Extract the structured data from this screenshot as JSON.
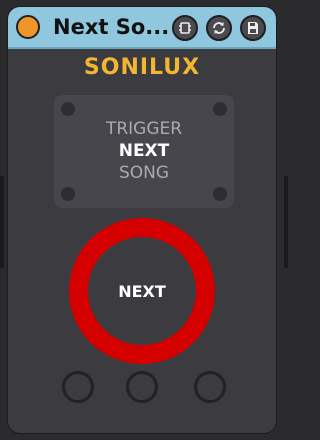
{
  "window": {
    "title": "Next So...",
    "status_color": "#f0952b",
    "buttons": [
      {
        "name": "device-icon"
      },
      {
        "name": "refresh-icon"
      },
      {
        "name": "save-icon"
      }
    ]
  },
  "brand": "SONILUX",
  "panel": {
    "line1": "TRIGGER",
    "line2": "NEXT",
    "line3": "SONG"
  },
  "trigger_button": {
    "label": "NEXT",
    "ring_color": "#d40000"
  },
  "colors": {
    "titlebar": "#8fc7de",
    "brand": "#f2b630",
    "body": "#3b3b40"
  }
}
